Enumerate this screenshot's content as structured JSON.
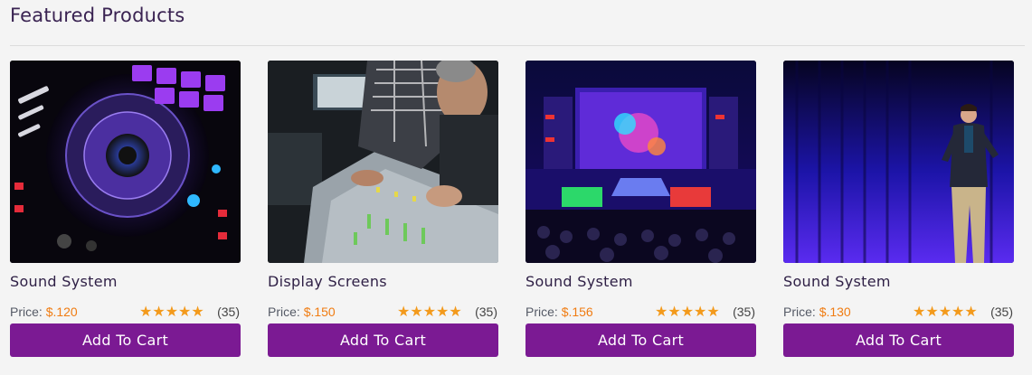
{
  "section": {
    "title": "Featured Products"
  },
  "colors": {
    "accent": "#7b1a93",
    "price": "#f07c12",
    "star": "#f39a1c"
  },
  "products": [
    {
      "name": "Sound System",
      "price_label": "Price: ",
      "price": "$.120",
      "stars": "★★★★★",
      "rating": 5,
      "reviews": "(35)",
      "button": "Add To Cart"
    },
    {
      "name": "Display Screens",
      "price_label": "Price: ",
      "price": "$.150",
      "stars": "★★★★★",
      "rating": 5,
      "reviews": "(35)",
      "button": "Add To Cart"
    },
    {
      "name": "Sound System",
      "price_label": "Price: ",
      "price": "$.156",
      "stars": "★★★★★",
      "rating": 5,
      "reviews": "(35)",
      "button": "Add To Cart"
    },
    {
      "name": "Sound System",
      "price_label": "Price: ",
      "price": "$.130",
      "stars": "★★★★★",
      "rating": 5,
      "reviews": "(35)",
      "button": "Add To Cart"
    }
  ]
}
